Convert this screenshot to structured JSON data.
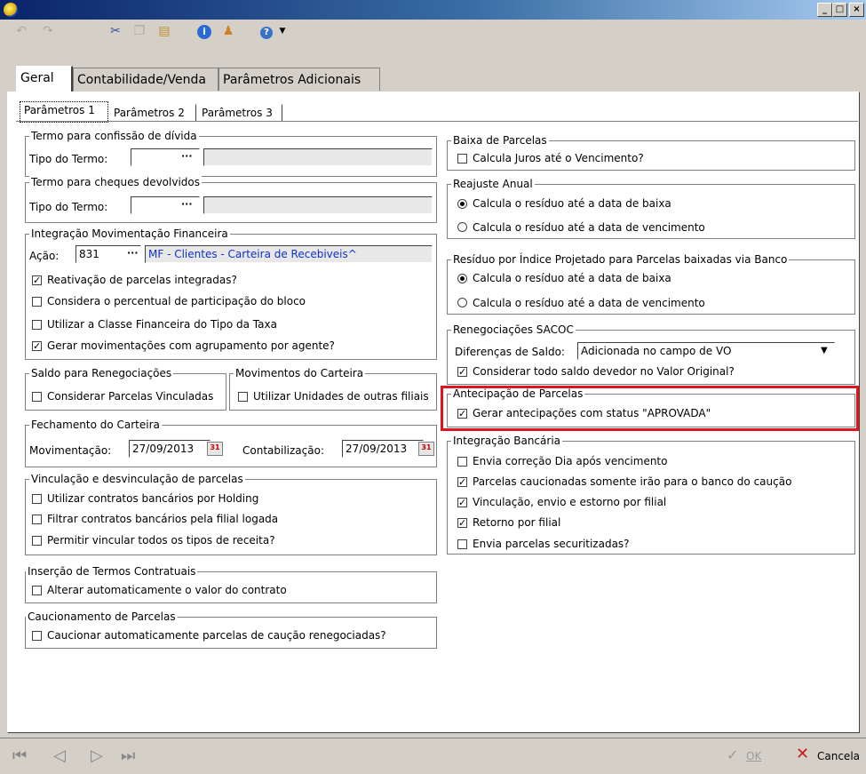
{
  "window": {
    "min_label": "_",
    "max_label": "□",
    "close_label": "×"
  },
  "toolbar": {
    "icons": [
      "undo-icon",
      "redo-icon",
      "cut-icon",
      "copy-icon",
      "paste-icon",
      "info-icon",
      "user-icon",
      "help-icon",
      "dropdown-arrow-icon"
    ]
  },
  "tabs": {
    "geral": "Geral",
    "contabilidade": "Contabilidade/Venda",
    "adicionais": "Parâmetros Adicionais"
  },
  "subtabs": {
    "p1": "Parâmetros 1",
    "p2": "Parâmetros 2",
    "p3": "Parâmetros 3"
  },
  "confissao": {
    "legend": "Termo para confissão de dívida",
    "label": "Tipo do Termo:"
  },
  "cheques": {
    "legend": "Termo para cheques devolvidos",
    "label": "Tipo do Termo:"
  },
  "integracao": {
    "legend": "Integração Movimentação Financeira",
    "acao_label": "Ação:",
    "acao_value": "831",
    "acao_desc": "MF - Clientes - Carteira de Recebiveis^",
    "items": [
      {
        "label": "Reativação de parcelas integradas?",
        "checked": true
      },
      {
        "label": "Considera o percentual de participação do bloco",
        "checked": false
      },
      {
        "label": "Utilizar a Classe Financeira do Tipo da Taxa",
        "checked": false
      },
      {
        "label": "Gerar movimentações com agrupamento por agente?",
        "checked": true
      }
    ]
  },
  "saldo": {
    "legend": "Saldo para Renegociações",
    "item": "Considerar Parcelas Vinculadas"
  },
  "movimentos": {
    "legend": "Movimentos do Carteira",
    "item": "Utilizar Unidades de outras filiais"
  },
  "fechamento": {
    "legend": "Fechamento do Carteira",
    "mov_label": "Movimentação:",
    "mov_value": "27/09/2013",
    "cont_label": "Contabilização:",
    "cont_value": "27/09/2013",
    "cal_glyph": "31"
  },
  "vinculacao": {
    "legend": "Vinculação e desvinculação de parcelas",
    "items": [
      {
        "label": "Utilizar contratos bancários por Holding",
        "checked": false
      },
      {
        "label": "Filtrar contratos bancários pela filial logada",
        "checked": false
      },
      {
        "label": "Permitir vincular todos os tipos de receita?",
        "checked": false
      }
    ]
  },
  "insercao": {
    "legend": "Inserção de Termos Contratuais",
    "item": "Alterar automaticamente o valor do contrato"
  },
  "caucionamento": {
    "legend": "Caucionamento de Parcelas",
    "item": "Caucionar automaticamente parcelas de caução renegociadas?"
  },
  "baixa": {
    "legend": "Baixa de Parcelas",
    "item": "Calcula Juros até o Vencimento?"
  },
  "reajuste": {
    "legend": "Reajuste Anual",
    "opt1": "Calcula o resíduo até a data de baixa",
    "opt2": "Calcula o resíduo até a data de vencimento"
  },
  "residuo": {
    "legend": "Resíduo por Índice Projetado para Parcelas baixadas via Banco",
    "opt1": "Calcula o resíduo até a data de baixa",
    "opt2": "Calcula o resíduo até a data de vencimento"
  },
  "sacoc": {
    "legend": "Renegociações SACOC",
    "dif_label": "Diferenças de Saldo:",
    "dif_value": "Adicionada no campo de VO",
    "item": "Considerar todo saldo devedor no Valor Original?"
  },
  "antecipacao": {
    "legend": "Antecipação de Parcelas",
    "item": "Gerar antecipações com status \"APROVADA\"",
    "highlight_color": "#e0141e"
  },
  "bancaria": {
    "legend": "Integração Bancária",
    "items": [
      {
        "label": "Envia correção Dia após vencimento",
        "checked": false
      },
      {
        "label": "Parcelas caucionadas somente irão para o banco do caução",
        "checked": true
      },
      {
        "label": "Vinculação, envio e estorno por filial",
        "checked": true
      },
      {
        "label": "Retorno por filial",
        "checked": true
      },
      {
        "label": "Envia parcelas securitizadas?",
        "checked": false
      }
    ]
  },
  "footer": {
    "ok": "OK",
    "cancel": "Cancela"
  },
  "check_glyph": "✓"
}
